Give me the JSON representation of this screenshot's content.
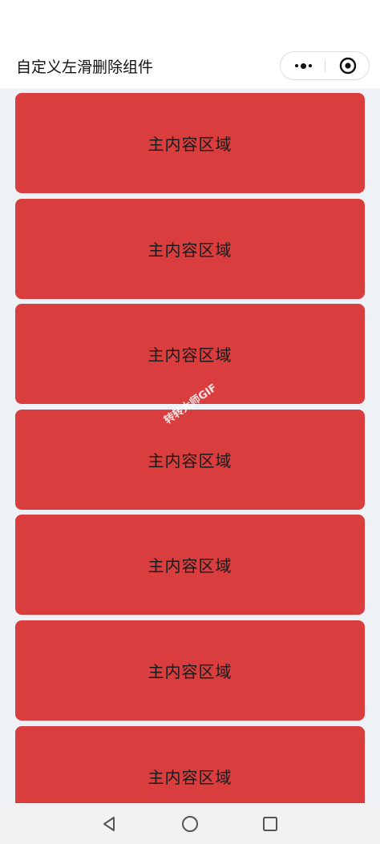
{
  "nav": {
    "title": "自定义左滑删除组件",
    "more_icon": "more-dots-icon",
    "close_icon": "target-circle-icon"
  },
  "list": {
    "items": [
      {
        "label": "主内容区域"
      },
      {
        "label": "主内容区域"
      },
      {
        "label": "主内容区域"
      },
      {
        "label": "主内容区域"
      },
      {
        "label": "主内容区域"
      },
      {
        "label": "主内容区域"
      },
      {
        "label": "主内容区域"
      }
    ]
  },
  "watermark": {
    "text": "转转大师GIF"
  },
  "system_nav": {
    "back_icon": "triangle-back-icon",
    "home_icon": "circle-home-icon",
    "recents_icon": "square-recents-icon"
  },
  "colors": {
    "card_bg": "#d93d3e",
    "page_bg": "#eef2f6"
  }
}
